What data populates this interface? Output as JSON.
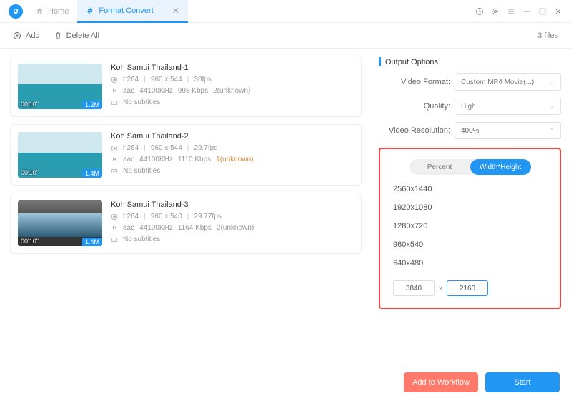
{
  "tabs": {
    "home": "Home",
    "active": "Format Convert"
  },
  "toolbar": {
    "add": "Add",
    "deleteAll": "Delete All",
    "count": "3 files"
  },
  "files": [
    {
      "title": "Koh Samui Thailand-1",
      "dur": "00'10\"",
      "size": "1.2M",
      "thumb": "sea",
      "vcodec": "h264",
      "res": "960  x  544",
      "fps": "30fps",
      "acodec": "aac",
      "arate": "44100KHz",
      "abit": "998 Kbps",
      "achan": "2(unknown)",
      "sub": "No subtitles"
    },
    {
      "title": "Koh Samui Thailand-2",
      "dur": "00'10\"",
      "size": "1.4M",
      "thumb": "sea",
      "vcodec": "h264",
      "res": "960  x  544",
      "fps": "29.7fps",
      "acodec": "aac",
      "arate": "44100KHz",
      "abit": "1110 Kbps",
      "achan": "1(unknown)",
      "sub": "No subtitles"
    },
    {
      "title": "Koh Samui Thailand-3",
      "dur": "00'10\"",
      "size": "1.4M",
      "thumb": "room",
      "vcodec": "h264",
      "res": "960  x  540",
      "fps": "29.77fps",
      "acodec": "aac",
      "arate": "44100KHz",
      "abit": "1164 Kbps",
      "achan": "2(unknown)",
      "sub": "No subtitles"
    }
  ],
  "output": {
    "header": "Output Options",
    "format": {
      "label": "Video Format:",
      "value": "Custom MP4 Movie(...)"
    },
    "quality": {
      "label": "Quality:",
      "value": "High"
    },
    "resolution": {
      "label": "Video Resolution:",
      "value": "400%"
    },
    "segPercent": "Percent",
    "segWH": "Width*Height",
    "presets": [
      "2560x1440",
      "1920x1080",
      "1280x720",
      "960x540",
      "640x480"
    ],
    "customW": "3840",
    "customH": "2160",
    "x": "x"
  },
  "footer": {
    "workflow": "Add to Workflow",
    "start": "Start"
  }
}
